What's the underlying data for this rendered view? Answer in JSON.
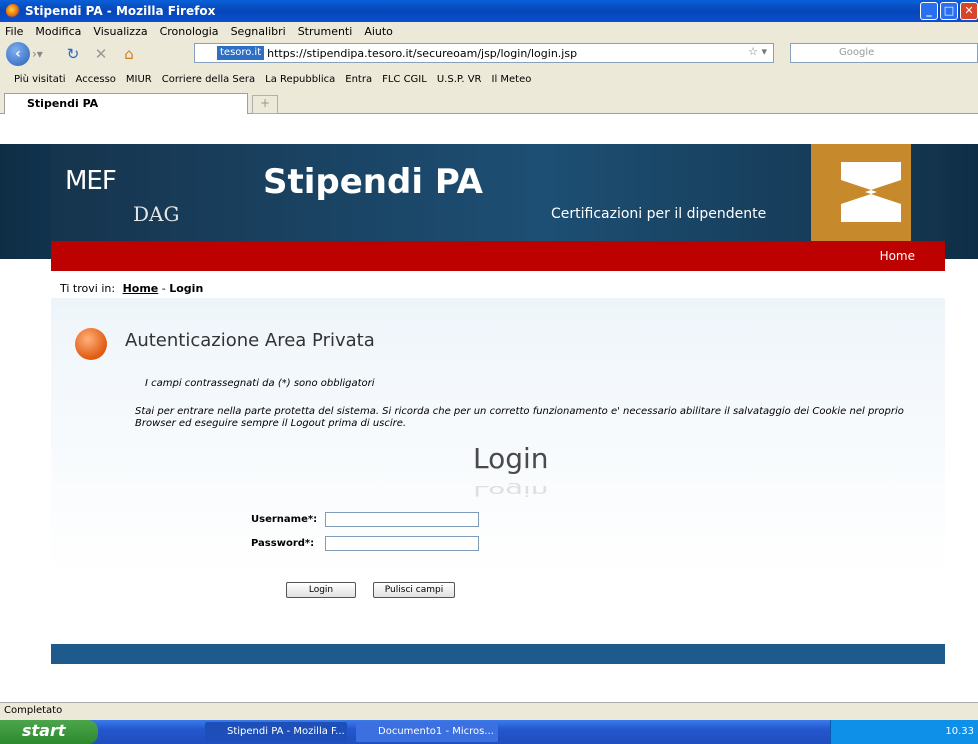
{
  "window": {
    "title": "Stipendi PA - Mozilla Firefox"
  },
  "menu": [
    "File",
    "Modifica",
    "Visualizza",
    "Cronologia",
    "Segnalibri",
    "Strumenti",
    "Aiuto"
  ],
  "navbar": {
    "site_badge": "tesoro.it",
    "url": "https://stipendipa.tesoro.it/secureoam/jsp/login/login.jsp",
    "search_placeholder": "Google"
  },
  "bookmarks": [
    "Più visitati",
    "Accesso",
    "MIUR",
    "Corriere della Sera",
    "La Repubblica",
    "Entra",
    "FLC CGIL",
    "U.S.P. VR",
    "Il Meteo"
  ],
  "tabs": [
    {
      "label": "Stipendi PA"
    }
  ],
  "site": {
    "logo_mef": "MEF",
    "logo_dag": "DAG",
    "brand": "Stipendi PA",
    "subtitle": "Certificazioni per il dipendente",
    "home_link": "Home",
    "breadcrumb": {
      "prefix": "Ti trovi in:",
      "home": "Home",
      "sep": "-",
      "current": "Login"
    },
    "area_title": "Autenticazione Area Privata",
    "required_note": "I campi contrassegnati da (*) sono obbligatori",
    "notice": "Stai per entrare nella parte protetta del sistema. Si ricorda che per un corretto funzionamento e' necessario abilitare il salvataggio dei Cookie nel proprio Browser ed eseguire sempre il Logout prima di uscire.",
    "login_heading": "Login",
    "username_label": "Username*:",
    "password_label": "Password*:",
    "username_value": "",
    "password_value": "",
    "login_button": "Login",
    "clear_button": "Pulisci campi"
  },
  "status": "Completato",
  "taskbar": {
    "start": "start",
    "tasks": [
      "Stipendi PA - Mozilla F...",
      "Documento1 - Micros..."
    ],
    "clock": "10.33"
  }
}
